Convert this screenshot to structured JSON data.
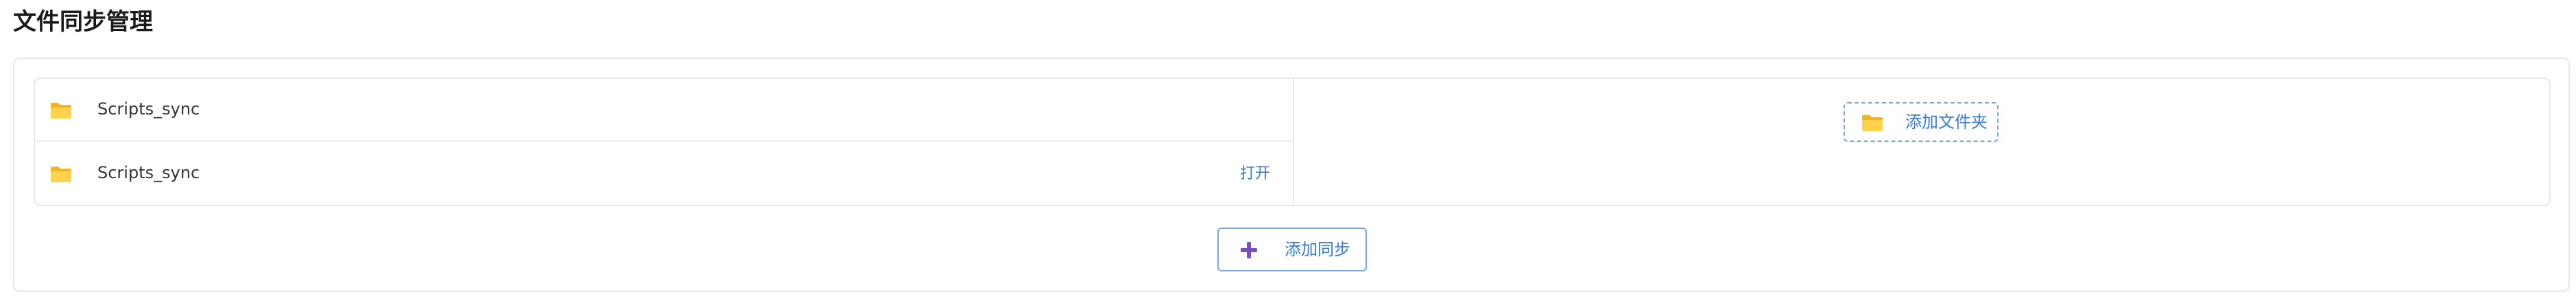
{
  "page": {
    "title": "文件同步管理"
  },
  "sync_list": {
    "folders": [
      {
        "name": "Scripts_sync",
        "action": ""
      },
      {
        "name": "Scripts_sync",
        "action": "打开"
      }
    ]
  },
  "add_folder": {
    "label": "添加文件夹",
    "icon": "folder-icon"
  },
  "add_sync": {
    "label": "添加同步",
    "icon": "plus-icon"
  },
  "colors": {
    "accent": "#3a7bd5",
    "folder": "#f5c12e",
    "plus": "#7a4fc2",
    "border": "#e8e8e8"
  }
}
